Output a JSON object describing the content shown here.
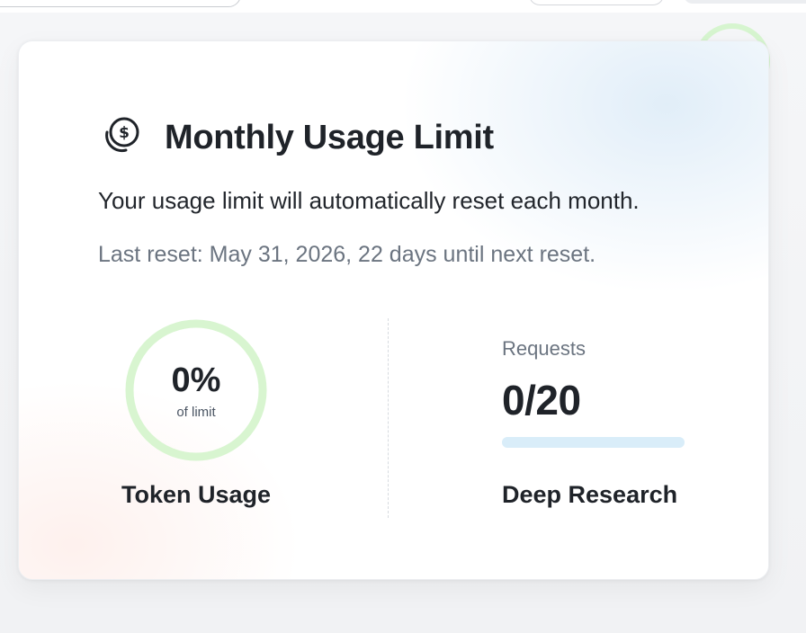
{
  "card": {
    "title": "Monthly Usage Limit",
    "description": "Your usage limit will automatically reset each month.",
    "reset_info": "Last reset: May 31, 2026, 22 days until next reset.",
    "icon": "coin-dollar-icon"
  },
  "token_usage": {
    "percent_label": "0%",
    "sub_label": "of limit",
    "label": "Token Usage",
    "percent_value": 0,
    "ring_color": "#d8f5d0",
    "progress_color": "#22c55e"
  },
  "deep_research": {
    "requests_label": "Requests",
    "requests_value": "0/20",
    "used": 0,
    "limit": 20,
    "label": "Deep Research",
    "bar_color": "#d9edf9"
  }
}
